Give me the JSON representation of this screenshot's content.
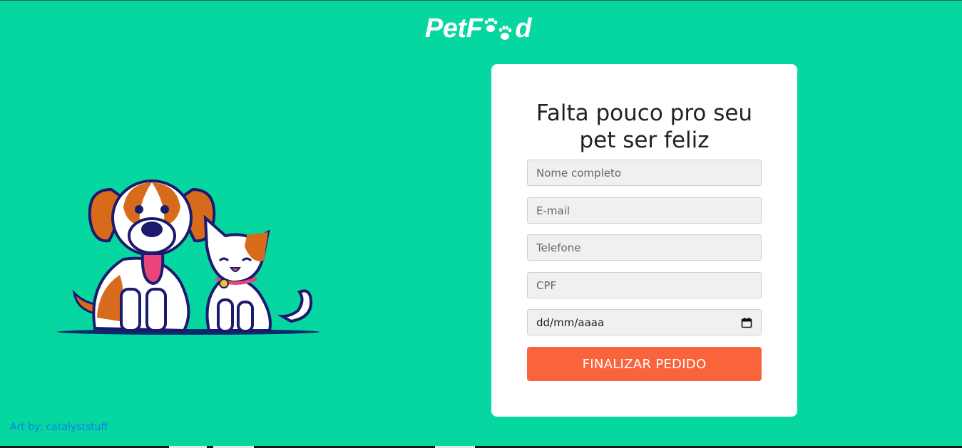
{
  "header": {
    "logo_prefix": "PetF",
    "logo_suffix": "d",
    "logo_icon": "paw-prints-icon"
  },
  "hero": {
    "illustration": "dog-and-cat-illustration",
    "credit": "Art by: catalyststuff"
  },
  "form": {
    "title_line1": "Falta pouco pro seu",
    "title_line2": "pet ser feliz",
    "name_placeholder": "Nome completo",
    "email_placeholder": "E-mail",
    "phone_placeholder": "Telefone",
    "cpf_placeholder": "CPF",
    "date_placeholder": "dd/mm/aaaa",
    "date_icon": "calendar-icon",
    "submit_label": "FINALIZAR PEDIDO"
  },
  "colors": {
    "background": "#06d6a0",
    "button": "#f9643d",
    "card": "#ffffff",
    "credit_link": "#0d7df0"
  }
}
